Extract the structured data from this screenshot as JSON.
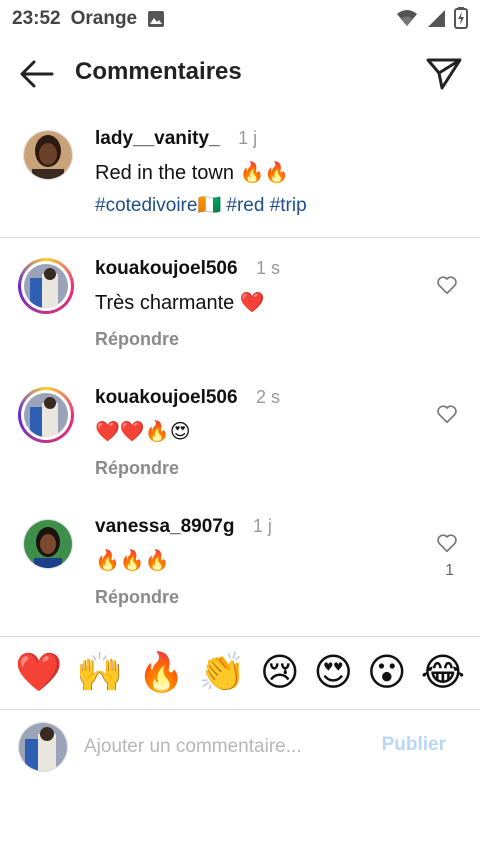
{
  "status_bar": {
    "time": "23:52",
    "carrier": "Orange"
  },
  "header": {
    "title": "Commentaires"
  },
  "caption": {
    "username": "lady__vanity_",
    "age": "1 j",
    "text": "Red in the town 🔥🔥",
    "hashtags": "#cotedivoire🇨🇮 #red #trip"
  },
  "comments": [
    {
      "username": "kouakoujoel506",
      "age": "1 s",
      "text": "Très charmante ❤️",
      "reply": "Répondre",
      "likes": ""
    },
    {
      "username": "kouakoujoel506",
      "age": "2 s",
      "text": "❤️❤️🔥😍",
      "reply": "Répondre",
      "likes": ""
    },
    {
      "username": "vanessa_8907g",
      "age": "1 j",
      "text": "🔥🔥🔥",
      "reply": "Répondre",
      "likes": "1"
    }
  ],
  "emoji_bar": [
    "❤️",
    "🙌",
    "🔥",
    "👏",
    "😢",
    "😍",
    "😮",
    "😂"
  ],
  "composer": {
    "placeholder": "Ajouter un commentaire...",
    "publish_label": "Publier"
  },
  "colors": {
    "hashtag": "#1f4e8c",
    "publish_disabled": "#b7d7f7",
    "divider": "#dbdbdb"
  }
}
